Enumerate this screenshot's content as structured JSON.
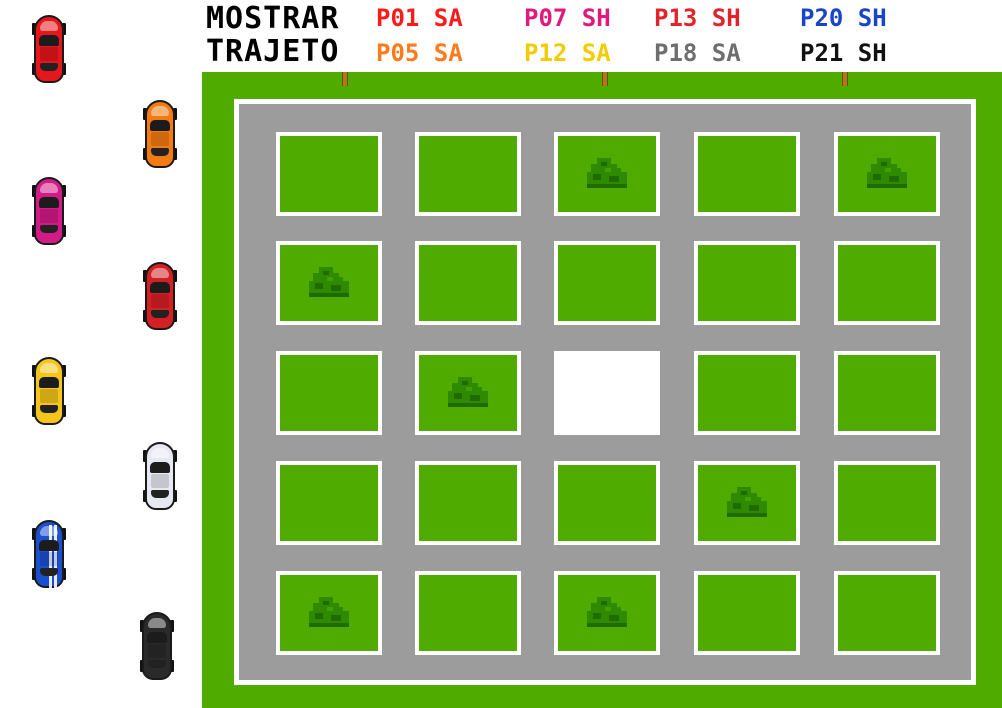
{
  "menu": {
    "mostrar_label": "MOSTRAR",
    "trajeto_label": "TRAJETO"
  },
  "legend": [
    {
      "label": "P01 SA",
      "color": "#ff1a1a"
    },
    {
      "label": "P05 SA",
      "color": "#ff7a1a"
    },
    {
      "label": "P07 SH",
      "color": "#e0197d"
    },
    {
      "label": "P12 SA",
      "color": "#f2cc00"
    },
    {
      "label": "P13 SH",
      "color": "#e0242b"
    },
    {
      "label": "P18 SA",
      "color": "#6e6e6e"
    },
    {
      "label": "P20 SH",
      "color": "#1946c8"
    },
    {
      "label": "P21 SH",
      "color": "#111111"
    }
  ],
  "cars": [
    {
      "name": "red-car",
      "color": "#e5161c",
      "icon": "sports-car-icon"
    },
    {
      "name": "orange-car",
      "color": "#f27b12",
      "icon": "race-car-icon"
    },
    {
      "name": "magenta-car",
      "color": "#d31a86",
      "icon": "sports-car-icon"
    },
    {
      "name": "dark-red-car",
      "color": "#d41f24",
      "icon": "sports-car-icon"
    },
    {
      "name": "yellow-car",
      "color": "#f4c51b",
      "icon": "sports-car-icon"
    },
    {
      "name": "white-car",
      "color": "#e8e8f2",
      "icon": "sports-car-icon"
    },
    {
      "name": "blue-car",
      "color": "#1a4fcf",
      "icon": "striped-sports-car-icon"
    },
    {
      "name": "black-car",
      "color": "#2a2a2a",
      "icon": "race-car-icon"
    }
  ],
  "map": {
    "grass_color": "#4fab00",
    "road_color": "#9c9c9c",
    "curb_colors": [
      "#e52020",
      "#ffffff"
    ],
    "destination_block": {
      "row": 3,
      "col": 3
    },
    "bush_blocks": [
      {
        "row": 1,
        "col": 3
      },
      {
        "row": 1,
        "col": 5
      },
      {
        "row": 2,
        "col": 1
      },
      {
        "row": 3,
        "col": 2
      },
      {
        "row": 4,
        "col": 4
      },
      {
        "row": 5,
        "col": 1
      },
      {
        "row": 5,
        "col": 3
      }
    ]
  }
}
